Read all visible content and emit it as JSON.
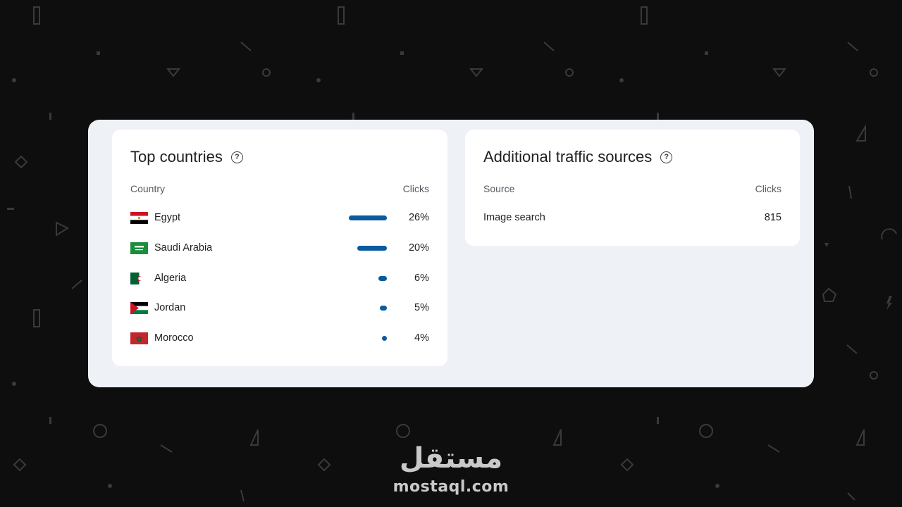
{
  "countries_card": {
    "title": "Top countries",
    "help_icon": "help-circle-icon",
    "col_country": "Country",
    "col_clicks": "Clicks",
    "rows": [
      {
        "country": "Egypt",
        "clicks": "26%",
        "share": 0.26,
        "flag": "egypt-flag-icon"
      },
      {
        "country": "Saudi Arabia",
        "clicks": "20%",
        "share": 0.2,
        "flag": "saudi-arabia-flag-icon"
      },
      {
        "country": "Algeria",
        "clicks": "6%",
        "share": 0.06,
        "flag": "algeria-flag-icon"
      },
      {
        "country": "Jordan",
        "clicks": "5%",
        "share": 0.05,
        "flag": "jordan-flag-icon"
      },
      {
        "country": "Morocco",
        "clicks": "4%",
        "share": 0.04,
        "flag": "morocco-flag-icon"
      }
    ]
  },
  "sources_card": {
    "title": "Additional traffic sources",
    "help_icon": "help-circle-icon",
    "col_source": "Source",
    "col_clicks": "Clicks",
    "rows": [
      {
        "source": "Image search",
        "clicks": "815"
      }
    ]
  },
  "watermark": {
    "arabic": "مستقل",
    "latin": "mostaql.com"
  },
  "colors": {
    "bar": "#0b5aa0",
    "panel": "#eef1f6",
    "background": "#0e0e0e"
  }
}
